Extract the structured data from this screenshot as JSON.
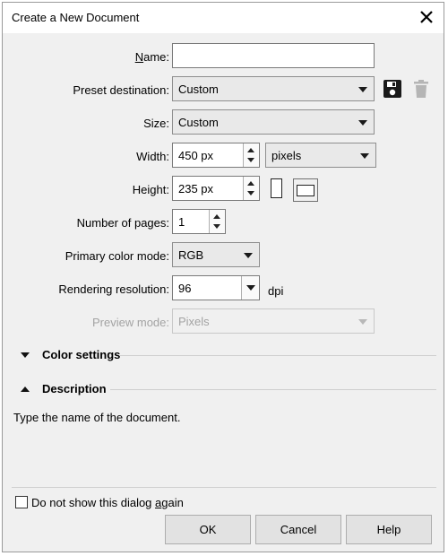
{
  "dialog": {
    "title": "Create a New Document"
  },
  "fields": {
    "name": {
      "label": "Name:",
      "value": ""
    },
    "preset_destination": {
      "label": "Preset destination:",
      "value": "Custom"
    },
    "size": {
      "label": "Size:",
      "value": "Custom"
    },
    "width": {
      "label": "Width:",
      "value": "450 px",
      "unit": "pixels"
    },
    "height": {
      "label": "Height:",
      "value": "235 px"
    },
    "pages": {
      "label": "Number of pages:",
      "value": "1"
    },
    "color_mode": {
      "label": "Primary color mode:",
      "value": "RGB"
    },
    "resolution": {
      "label": "Rendering resolution:",
      "value": "96",
      "unit": "dpi"
    },
    "preview_mode": {
      "label": "Preview mode:",
      "value": "Pixels"
    }
  },
  "sections": {
    "color_settings": "Color settings",
    "description": "Description",
    "description_text": "Type the name of the document."
  },
  "footer": {
    "dont_show_label": "Do not show this dialog again",
    "dont_show_checked": false,
    "ok": "OK",
    "cancel": "Cancel",
    "help": "Help"
  },
  "icons": [
    "close-icon",
    "save-preset-icon",
    "delete-preset-icon",
    "portrait-icon",
    "landscape-icon"
  ]
}
